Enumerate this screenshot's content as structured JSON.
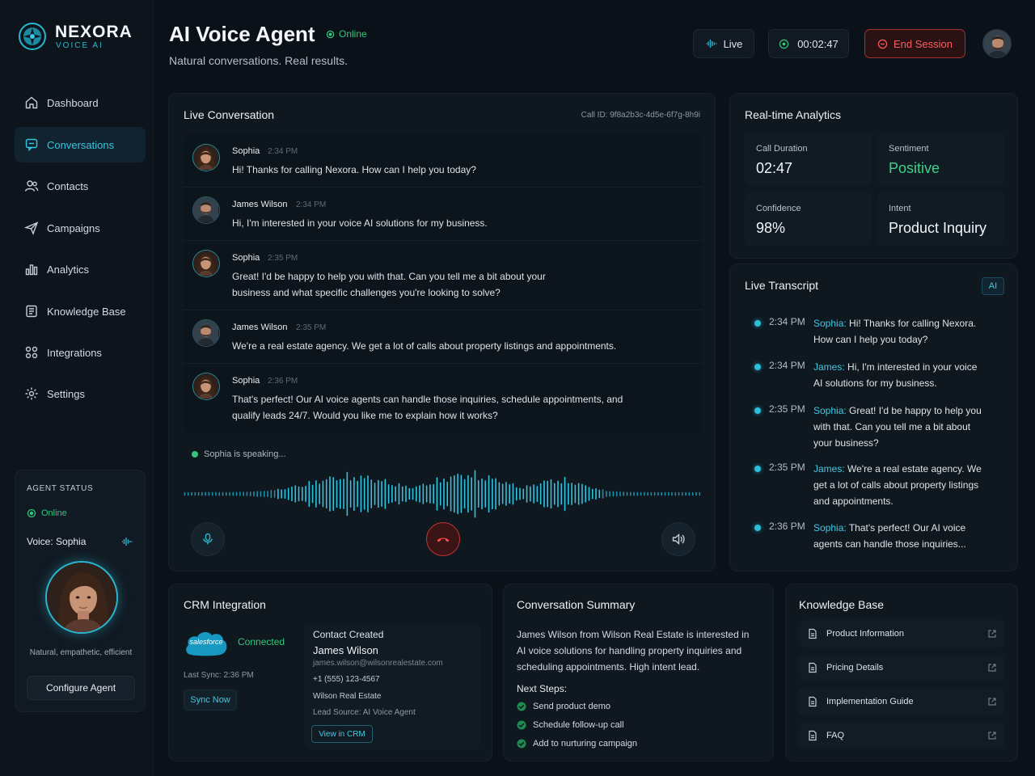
{
  "brand": {
    "name": "NEXORA",
    "sub": "VOICE AI"
  },
  "nav": [
    {
      "label": "Dashboard",
      "icon": "home-icon"
    },
    {
      "label": "Conversations",
      "icon": "chat-icon",
      "active": true
    },
    {
      "label": "Contacts",
      "icon": "users-icon"
    },
    {
      "label": "Campaigns",
      "icon": "send-icon"
    },
    {
      "label": "Analytics",
      "icon": "bar-chart-icon"
    },
    {
      "label": "Knowledge Base",
      "icon": "book-icon"
    },
    {
      "label": "Integrations",
      "icon": "grid-icon"
    },
    {
      "label": "Settings",
      "icon": "gear-icon"
    }
  ],
  "agent_status": {
    "label": "AGENT STATUS",
    "status": "Online",
    "voice": "Voice: Sophia",
    "description": "Natural, empathetic, efficient",
    "configure": "Configure Agent"
  },
  "header": {
    "title": "AI Voice Agent",
    "status": "Online",
    "subtitle": "Natural conversations. Real results.",
    "live": "Live",
    "timer": "00:02:47",
    "end_session": "End Session"
  },
  "conversation": {
    "title": "Live Conversation",
    "call_id": "Call ID: 9f8a2b3c-4d5e-6f7g-8h9i",
    "messages": [
      {
        "name": "Sophia",
        "time": "2:34 PM",
        "text": "Hi! Thanks for calling Nexora. How can I help you today?"
      },
      {
        "name": "James Wilson",
        "time": "2:34 PM",
        "text": "Hi, I'm interested in your voice AI solutions for my business."
      },
      {
        "name": "Sophia",
        "time": "2:35 PM",
        "text": "Great! I'd be happy to help you with that. Can you tell me a bit about your business and what specific challenges you're looking to solve?"
      },
      {
        "name": "James Wilson",
        "time": "2:35 PM",
        "text": "We're a real estate agency. We get a lot of calls about property listings and appointments."
      },
      {
        "name": "Sophia",
        "time": "2:36 PM",
        "text": "That's perfect! Our AI voice agents can handle those inquiries, schedule appointments, and qualify leads 24/7. Would you like me to explain how it works?"
      }
    ],
    "speaking": "Sophia is speaking..."
  },
  "analytics": {
    "title": "Real-time Analytics",
    "stats": [
      {
        "label": "Call Duration",
        "value": "02:47"
      },
      {
        "label": "Sentiment",
        "value": "Positive"
      },
      {
        "label": "Confidence",
        "value": "98%"
      },
      {
        "label": "Intent",
        "value": "Product Inquiry"
      }
    ],
    "positive_color": "#3fd18a"
  },
  "transcript": {
    "title": "Live Transcript",
    "badge": "AI",
    "rows": [
      {
        "time": "2:34 PM",
        "speaker": "Sophia:",
        "text": "Hi! Thanks for calling Nexora. How can I help you today?"
      },
      {
        "time": "2:34 PM",
        "speaker": "James:",
        "text": "Hi, I'm interested in your voice AI solutions for my business."
      },
      {
        "time": "2:35 PM",
        "speaker": "Sophia:",
        "text": "Great! I'd be happy to help you with that. Can you tell me a bit about your business?"
      },
      {
        "time": "2:35 PM",
        "speaker": "James:",
        "text": "We're a real estate agency. We get a lot of calls about property listings and appointments."
      },
      {
        "time": "2:36 PM",
        "speaker": "Sophia:",
        "text": "That's perfect! Our AI voice agents can handle those inquiries..."
      }
    ]
  },
  "crm": {
    "title": "CRM Integration",
    "logo": "salesforce",
    "status": "Connected",
    "last_sync": "Last Sync: 2:36 PM",
    "sync": "Sync Now",
    "contact_title": "Contact Created",
    "name": "James Wilson",
    "email": "james.wilson@wilsonrealestate.com",
    "phone": "+1 (555) 123-4567",
    "company": "Wilson Real Estate",
    "source": "Lead Source: AI Voice Agent",
    "view": "View in CRM"
  },
  "summary": {
    "title": "Conversation Summary",
    "text": "James Wilson from Wilson Real Estate is interested in AI voice solutions for handling property inquiries and scheduling appointments. High intent lead.",
    "next_steps_label": "Next Steps:",
    "steps": [
      "Send product demo",
      "Schedule follow-up call",
      "Add to nurturing campaign"
    ]
  },
  "knowledge_base": {
    "title": "Knowledge Base",
    "items": [
      "Product Information",
      "Pricing Details",
      "Implementation Guide",
      "FAQ"
    ]
  },
  "colors": {
    "accent": "#2bb6cf",
    "success": "#34c77b",
    "danger": "#ff5c5c"
  }
}
